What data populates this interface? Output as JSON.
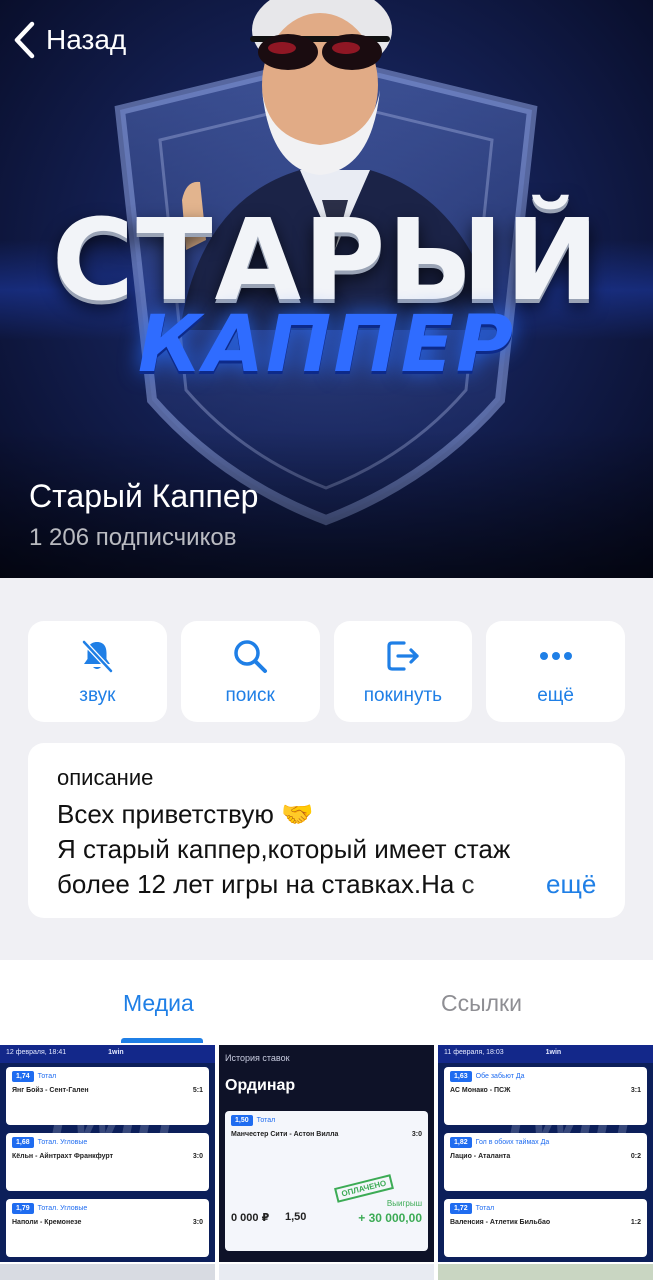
{
  "header": {
    "back_label": "Назад"
  },
  "hero": {
    "title_line1": "СТАРЫЙ",
    "title_line2": "КАППЕР"
  },
  "channel": {
    "name": "Старый Каппер",
    "subscribers": "1 206 подписчиков"
  },
  "actions": [
    {
      "label": "звук",
      "icon": "bell-slash-icon"
    },
    {
      "label": "поиск",
      "icon": "search-icon"
    },
    {
      "label": "покинуть",
      "icon": "leave-icon"
    },
    {
      "label": "ещё",
      "icon": "more-icon"
    }
  ],
  "description": {
    "title": "описание",
    "line1": "Всех приветствую 🤝",
    "line2": "Я старый каппер,который имеет стаж",
    "line3": "более 12 лет игры на ставках.На с",
    "more_label": "ещё"
  },
  "tabs": [
    {
      "label": "Медиа",
      "selected": true
    },
    {
      "label": "Ссылки",
      "selected": false
    }
  ],
  "media": [
    {
      "header": "12 февраля, 18:41",
      "brand": "1win",
      "bets": [
        {
          "coef": "1,74",
          "pick": "Тотал",
          "match": "Янг Бойз - Сент-Гален",
          "score": "5:1"
        },
        {
          "coef": "1,68",
          "pick": "Тотал. Угловые",
          "match": "Кёльн - Айнтрахт Франкфурт",
          "score": "3:0"
        },
        {
          "coef": "1,79",
          "pick": "Тотал. Угловые",
          "match": "Наполи - Кремонезе",
          "score": "3:0"
        }
      ]
    },
    {
      "header": "История ставок",
      "title": "Ординар",
      "bets": [
        {
          "coef": "1,50",
          "pick": "Тотал",
          "match": "Манчестер Сити - Астон Вилла",
          "score": "3:0"
        }
      ],
      "stamp": "ОПЛАЧЕНО",
      "win_label": "Выигрыш",
      "win_amount": "+ 30 000,00",
      "stake": "0 000 ₽",
      "coef_label": "1,50"
    },
    {
      "header": "11 февраля, 18:03",
      "brand": "1win",
      "bets": [
        {
          "coef": "1,63",
          "pick": "Обе забьют Да",
          "match": "АС Монако - ПСЖ",
          "score": "3:1"
        },
        {
          "coef": "1,82",
          "pick": "Гол в обоих таймах Да",
          "match": "Лацио - Аталанта",
          "score": "0:2"
        },
        {
          "coef": "1,72",
          "pick": "Тотал",
          "match": "Валенсия - Атлетик Бильбао",
          "score": "1:2"
        }
      ]
    }
  ],
  "colors": {
    "accent": "#1f7fe6",
    "background": "#f0f0f4",
    "card": "#ffffff",
    "muted": "#8e8e93"
  }
}
